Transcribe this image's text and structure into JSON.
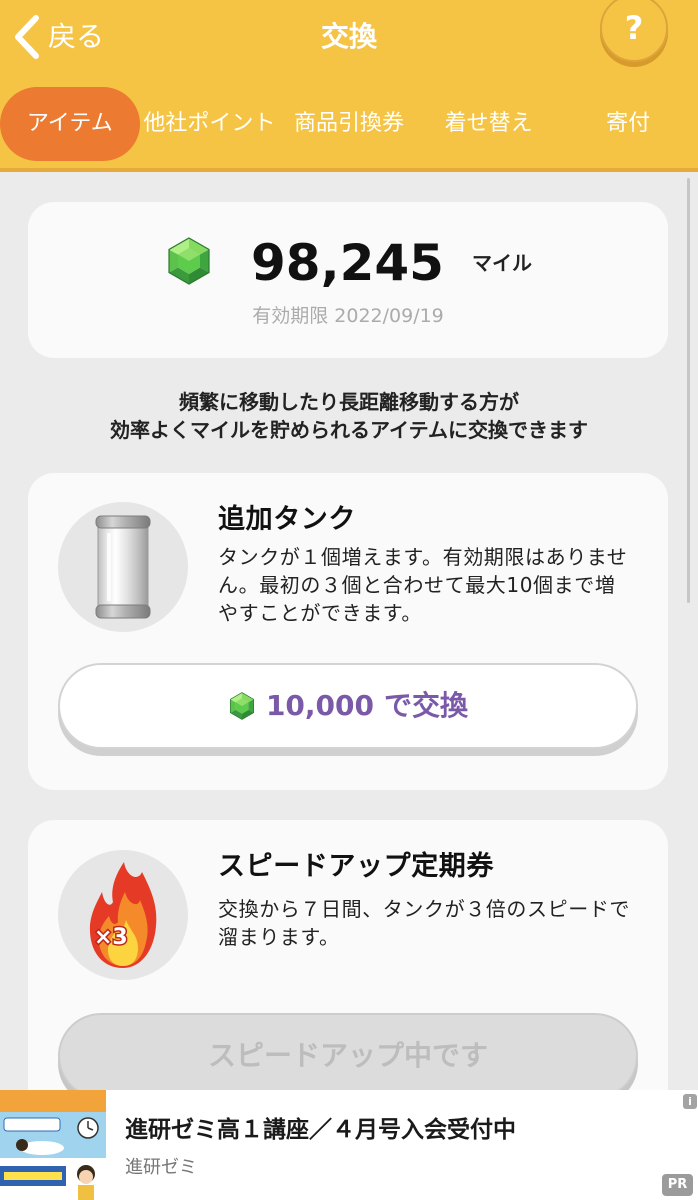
{
  "header": {
    "back_label": "戻る",
    "back_icon": "chevron-left-icon",
    "title": "交換",
    "help_label": "?",
    "tabs": [
      {
        "label": "アイテム",
        "active": true
      },
      {
        "label": "他社ポイント",
        "active": false
      },
      {
        "label": "商品引換券",
        "active": false
      },
      {
        "label": "着せ替え",
        "active": false
      },
      {
        "label": "寄付",
        "active": false
      }
    ]
  },
  "balance": {
    "icon": "green-gem-icon",
    "amount": "98,245",
    "unit": "マイル",
    "expiry_label": "有効期限",
    "expiry_date": "2022/09/19"
  },
  "intro": {
    "lines": [
      "頻繁に移動したり長距離移動する方が",
      "効率よくマイルを貯められるアイテムに交換できます"
    ]
  },
  "items": [
    {
      "icon": "tank-icon",
      "title": "追加タンク",
      "description_lines": [
        "タンクが１個増えます。有効期限はありませ",
        "ん。最初の３個と合わせて最大10個まで増",
        "やすことができます。"
      ],
      "button": {
        "icon": "green-gem-icon",
        "price": "10,000",
        "label": "で交換",
        "enabled": true
      }
    },
    {
      "icon": "flame-icon",
      "icon_badge": "×3",
      "title": "スピードアップ定期券",
      "description_lines": [
        "交換から７日間、タンクが３倍のスピードで",
        "溜まります。"
      ],
      "button": {
        "label": "スピードアップ中です",
        "enabled": false
      }
    }
  ],
  "ad": {
    "title": "進研ゼミ高１講座／４月号入会受付中",
    "advertiser": "進研ゼミ",
    "info_label": "i",
    "pr_label": "PR"
  },
  "colors": {
    "header_bg": "#F6C445",
    "active_tab": "#EC7A30",
    "page_bg": "#EBEBEB",
    "price_text": "#7A5AA8",
    "disabled_button": "#DCDCDC"
  }
}
